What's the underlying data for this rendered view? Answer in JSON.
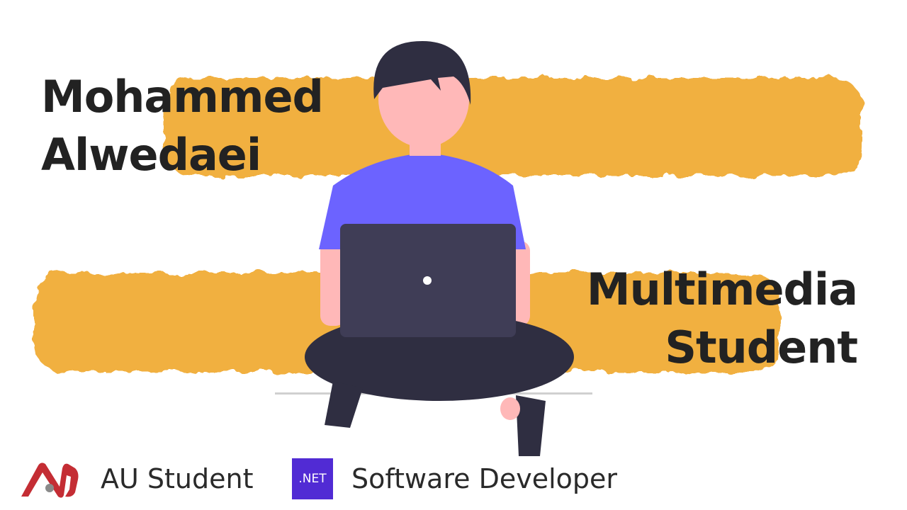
{
  "profile": {
    "name_line1": "Mohammed",
    "name_line2": "Alwedaei",
    "role_line1": "Multimedia",
    "role_line2": "Student"
  },
  "footer": {
    "au_label": "AU Student",
    "net_badge_text": ".NET",
    "net_label": "Software Developer"
  },
  "colors": {
    "brush": "#f1b040",
    "text": "#222222",
    "shirt": "#6c63ff",
    "pants": "#2f2e41",
    "skin": "#ffb8b8",
    "laptop": "#3f3d56",
    "net_badge": "#512bd4",
    "au_logo": "#c42d34"
  },
  "icons": {
    "au_logo": "au-logo-icon",
    "net_logo": "dotnet-icon",
    "illustration": "person-with-laptop-illustration"
  }
}
